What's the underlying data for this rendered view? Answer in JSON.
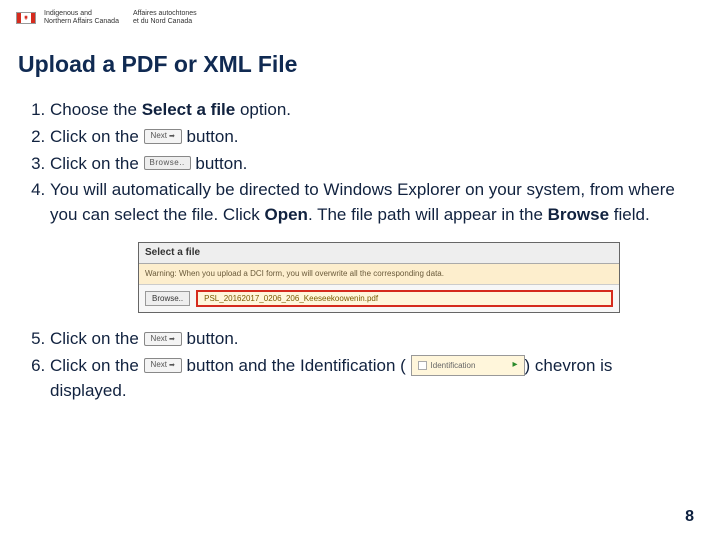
{
  "header": {
    "dept_en_l1": "Indigenous and",
    "dept_en_l2": "Northern Affairs Canada",
    "dept_fr_l1": "Affaires autochtones",
    "dept_fr_l2": "et du Nord Canada"
  },
  "title": "Upload a PDF or XML File",
  "buttons": {
    "next": "Next",
    "browse": "Browse.."
  },
  "ident": {
    "label": "Identification"
  },
  "steps": {
    "s1_pre": "Choose the ",
    "s1_bold": "Select a file",
    "s1_post": " option.",
    "s2_pre": "Click on the ",
    "s2_post": " button.",
    "s3_pre": "Click on the ",
    "s3_post": " button.",
    "s4_a": "You will automatically be directed to Windows Explorer on your system, from where you can select the file. Click ",
    "s4_bold1": "Open",
    "s4_b": ". The file path will appear in the ",
    "s4_bold2": "Browse",
    "s4_c": " field.",
    "s5_pre": "Click on the ",
    "s5_post": " button.",
    "s6_pre": "Click on the ",
    "s6_mid": " button and the Identification ( ",
    "s6_post": ") chevron is displayed."
  },
  "screenshot": {
    "title": "Select a file",
    "warning": "Warning: When you upload a DCI form, you will overwrite all the corresponding data.",
    "browse_label": "Browse..",
    "filepath": "PSL_20162017_0206_206_Keeseekoowenin.pdf"
  },
  "page_number": "8"
}
